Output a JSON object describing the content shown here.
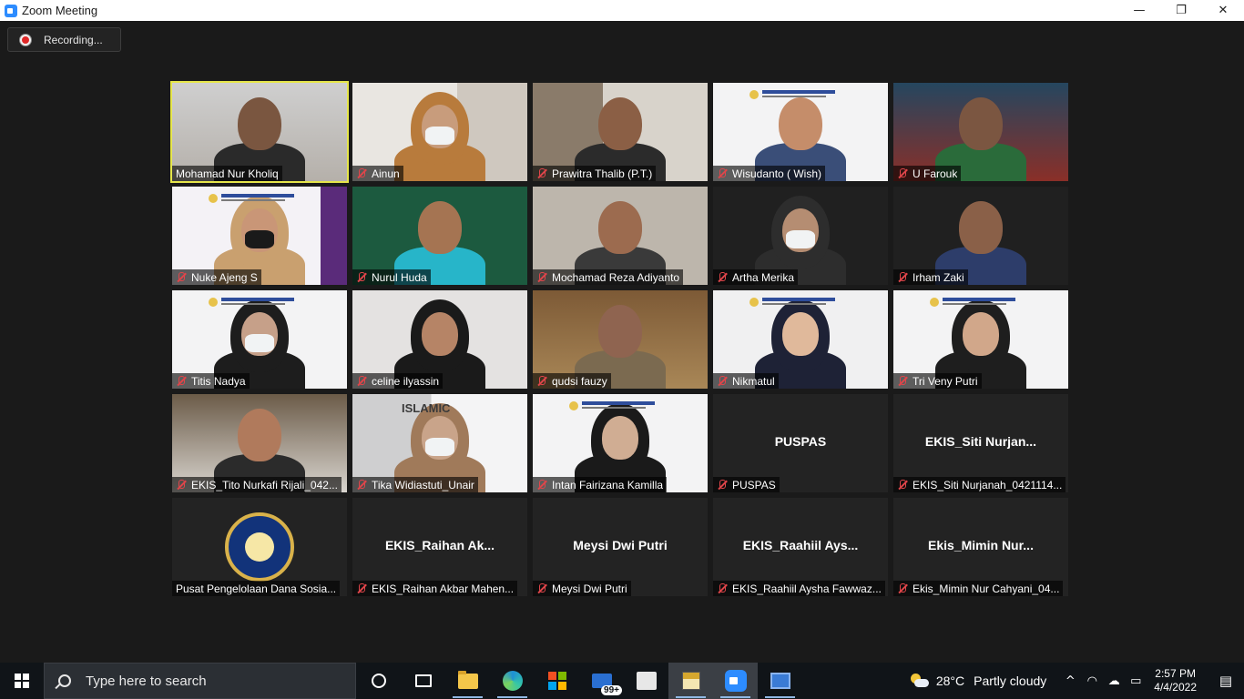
{
  "window": {
    "title": "Zoom Meeting",
    "minimize_glyph": "—",
    "restore_glyph": "❐",
    "close_glyph": "✕"
  },
  "recording": {
    "label": "Recording..."
  },
  "participants": [
    {
      "name": "Mohamad Nur Kholiq",
      "muted": false,
      "active_speaker": true,
      "video": true
    },
    {
      "name": "Ainun",
      "muted": true,
      "video": true
    },
    {
      "name": "Prawitra Thalib (P.T.)",
      "muted": true,
      "video": true
    },
    {
      "name": "Wisudanto ( Wish)",
      "muted": true,
      "video": true
    },
    {
      "name": "U Farouk",
      "muted": true,
      "video": true
    },
    {
      "name": "Nuke Ajeng S",
      "muted": true,
      "video": true
    },
    {
      "name": "Nurul Huda",
      "muted": true,
      "video": true
    },
    {
      "name": "Mochamad Reza Adiyanto",
      "muted": true,
      "video": true
    },
    {
      "name": "Artha Merika",
      "muted": true,
      "video": true
    },
    {
      "name": "Irham Zaki",
      "muted": true,
      "video": true
    },
    {
      "name": "Titis Nadya",
      "muted": true,
      "video": true
    },
    {
      "name": "celine ilyassin",
      "muted": true,
      "video": true
    },
    {
      "name": "qudsi fauzy",
      "muted": true,
      "video": true
    },
    {
      "name": "Nikmatul",
      "muted": true,
      "video": true
    },
    {
      "name": "Tri Veny Putri",
      "muted": true,
      "video": true
    },
    {
      "name": "EKIS_Tito Nurkafi Rijali_042...",
      "muted": true,
      "video": true
    },
    {
      "name": "Tika Widiastuti_Unair",
      "muted": true,
      "video": true,
      "slide_text": "ISLAMIC"
    },
    {
      "name": "Intan Fairizana Kamilla",
      "muted": true,
      "video": true
    },
    {
      "name": "PUSPAS",
      "muted": true,
      "video": false,
      "display_name": "PUSPAS"
    },
    {
      "name": "EKIS_Siti Nurjanah_0421114...",
      "muted": true,
      "video": false,
      "display_name": "EKIS_Siti  Nurjan..."
    },
    {
      "name": "Pusat Pengelolaan Dana Sosia...",
      "muted": false,
      "video": false,
      "logo": true
    },
    {
      "name": "EKIS_Raihan Akbar Mahen...",
      "muted": true,
      "video": false,
      "display_name": "EKIS_Raihan  Ak..."
    },
    {
      "name": "Meysi Dwi Putri",
      "muted": true,
      "video": false,
      "display_name": "Meysi Dwi Putri"
    },
    {
      "name": "EKIS_Raahiil Aysha Fawwaz...",
      "muted": true,
      "video": false,
      "display_name": "EKIS_Raahiil  Ays..."
    },
    {
      "name": "Ekis_Mimin Nur Cahyani_04...",
      "muted": true,
      "video": false,
      "display_name": "Ekis_Mimin  Nur..."
    }
  ],
  "taskbar": {
    "search_placeholder": "Type here to search",
    "mail_badge": "99+",
    "weather": {
      "temp": "28°C",
      "condition": "Partly cloudy"
    },
    "tray_chevron": "^",
    "clock": {
      "time": "2:57 PM",
      "date": "4/4/2022"
    }
  },
  "colors": {
    "active_speaker_border": "#e6e64a",
    "muted_icon": "#e0454a",
    "zoom_blue": "#2d8cff"
  }
}
